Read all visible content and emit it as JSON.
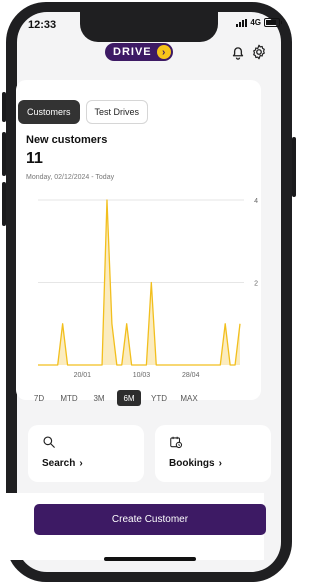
{
  "status": {
    "time": "12:33",
    "network": "4G"
  },
  "header": {
    "logo_text": "DRIVE",
    "logo_arrow": "›",
    "icons": [
      "bell-icon",
      "gear-icon"
    ]
  },
  "tabs": [
    {
      "label": "Customers",
      "active": true
    },
    {
      "label": "Test Drives",
      "active": false
    }
  ],
  "card": {
    "title": "New customers",
    "value": "11",
    "date_range": "Monday, 02/12/2024 - Today"
  },
  "chart_data": {
    "type": "area",
    "title": "",
    "xlabel": "",
    "ylabel": "",
    "ylim": [
      0,
      4
    ],
    "y_ticks": [
      "4",
      "2"
    ],
    "x_ticks": [
      "20/01",
      "10/03",
      "28/04"
    ],
    "series": [
      {
        "values": [
          0,
          0,
          0,
          0,
          0,
          1,
          0,
          0,
          0,
          0,
          0,
          0,
          0,
          0,
          4,
          1,
          0,
          0,
          1,
          0,
          0,
          0,
          0,
          2,
          0,
          0,
          0,
          0,
          0,
          0,
          0,
          0,
          0,
          0,
          0,
          0,
          0,
          0,
          1,
          0,
          0,
          1
        ]
      }
    ],
    "color": "#f2bf1d",
    "fill": "#fbecc0",
    "grid": true
  },
  "ranges": [
    {
      "label": "7D",
      "active": false
    },
    {
      "label": "MTD",
      "active": false
    },
    {
      "label": "3M",
      "active": false
    },
    {
      "label": "6M",
      "active": true
    },
    {
      "label": "YTD",
      "active": false
    },
    {
      "label": "MAX",
      "active": false
    }
  ],
  "tiles": [
    {
      "label": "Search",
      "arrow": "›",
      "icon": "search-icon"
    },
    {
      "label": "Bookings",
      "arrow": "›",
      "icon": "calendar-clock-icon"
    }
  ],
  "button": {
    "label": "Create Customer"
  },
  "colors": {
    "brand": "#3d1a64",
    "accent": "#f7c51a"
  }
}
